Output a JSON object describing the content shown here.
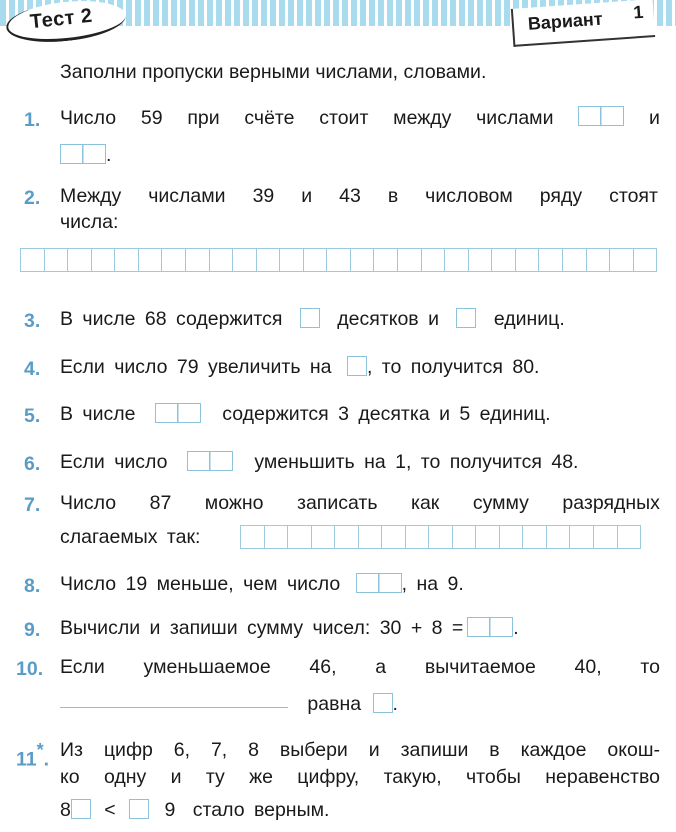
{
  "header": {
    "test_label": "Тест 2",
    "variant_label": "Вариант",
    "variant_number": "1",
    "stripe_color": "#a9dbef"
  },
  "instruction": "Заполни пропуски верными числами, словами.",
  "accent_color": "#5b9cc6",
  "tasks": [
    {
      "number": "1.",
      "line1": [
        "Число",
        "59",
        "при",
        "счёте",
        "стоит",
        "между",
        "числами"
      ],
      "after_box": "и",
      "line2_end": "."
    },
    {
      "number": "2.",
      "line1": [
        "Между",
        "числами",
        "39",
        "и",
        "43",
        "в",
        "числовом",
        "ряду",
        "стоят"
      ],
      "line2": "числа:",
      "grid_cells": 27
    },
    {
      "number": "3.",
      "part1": "В числе 68 содержится",
      "part2": "десятков и",
      "part3": "единиц."
    },
    {
      "number": "4.",
      "part1": "Если число 79 увеличить на",
      "part2": ", то получится 80."
    },
    {
      "number": "5.",
      "part1": "В числе",
      "part2": "содержится 3 десятка и 5 единиц."
    },
    {
      "number": "6.",
      "part1": "Если число",
      "part2": "уменьшить на 1, то получится 48."
    },
    {
      "number": "7.",
      "line1": [
        "Число",
        "87",
        "можно",
        "записать",
        "как",
        "сумму",
        "разрядных"
      ],
      "line2": "слагаемых так:",
      "grid_cells": 17
    },
    {
      "number": "8.",
      "part1": "Число 19 меньше, чем число",
      "part2": ", на 9."
    },
    {
      "number": "9.",
      "part1": "Вычисли и запиши сумму чисел: 30 + 8 =",
      "part2": "."
    },
    {
      "number": "10.",
      "line1": [
        "Если",
        "уменьшаемое",
        "46,",
        "а",
        "вычитаемое",
        "40,",
        "то"
      ],
      "part2": "равна",
      "part3": "."
    },
    {
      "number": "11",
      "star": "*",
      "dot": ".",
      "line1": [
        "Из",
        "цифр",
        "6,",
        "7,",
        "8",
        "выбери",
        "и",
        "запиши",
        "в",
        "каждое",
        "окош-"
      ],
      "line2": [
        "ко",
        "одну",
        "и",
        "ту",
        "же",
        "цифру,",
        "такую,",
        "чтобы",
        "неравенство"
      ],
      "ineq_left": "8",
      "ineq_op": "<",
      "ineq_right": "9",
      "line3_end": "стало верным."
    }
  ]
}
